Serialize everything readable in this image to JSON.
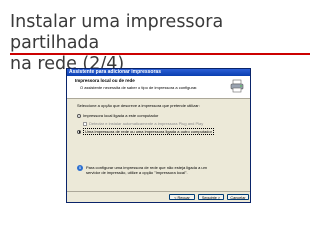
{
  "slide": {
    "title_line1": "Instalar uma impressora partilhada",
    "title_line2": "na rede (2/4)"
  },
  "window": {
    "title": "Assistente para adicionar impressoras",
    "header_title": "Impressora local ou de rede",
    "header_subtitle": "O assistente necessita de saber o tipo de impressora a configurar.",
    "header_icon": "printer-icon",
    "instruction": "Seleccione a opção que descreve a impressora que pretende utilizar:",
    "options": [
      {
        "label": "Impressora local ligada a este computador",
        "selected": false,
        "enabled": true
      },
      {
        "label": "Detectar e instalar automaticamente a impressora Plug and Play",
        "enabled": false
      },
      {
        "label": "Uma impressora de rede ou uma impressora ligada a outro computador",
        "selected": true,
        "enabled": true
      }
    ],
    "info_line1": "Para configurar uma impressora de rede que não esteja ligada a um",
    "info_line2": "servidor de impressão, utilize a opção \"Impressora local\".",
    "buttons": {
      "back": "< Recuar",
      "next": "Seguinte >",
      "cancel": "Cancelar"
    }
  }
}
